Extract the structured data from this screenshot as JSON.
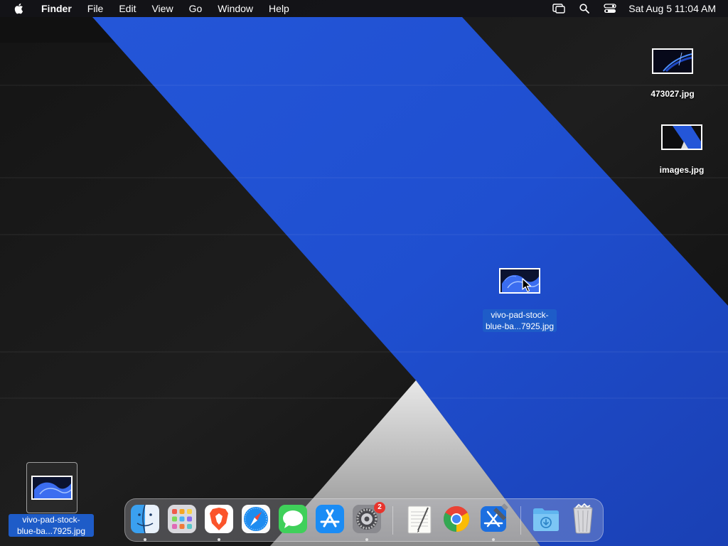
{
  "menubar": {
    "apple_icon": "apple-icon",
    "app_name": "Finder",
    "menus": [
      "File",
      "Edit",
      "View",
      "Go",
      "Window",
      "Help"
    ],
    "status_icons": [
      "screen-mirroring-icon",
      "spotlight-search-icon",
      "control-center-icon"
    ],
    "clock": "Sat Aug 5  11:04 AM"
  },
  "desktop": {
    "icons": [
      {
        "name": "473027.jpg",
        "selected": false
      },
      {
        "name": "images.jpg",
        "selected": false
      },
      {
        "name_line1": "vivo-pad-stock-",
        "name_line2": "blue-ba...7925.jpg",
        "selected": true
      }
    ],
    "drag_ghost": {
      "name_line1": "vivo-pad-stock-",
      "name_line2": "blue-ba...7925.jpg"
    }
  },
  "dock": {
    "apps": [
      {
        "name": "Finder",
        "icon": "finder-icon",
        "running": true
      },
      {
        "name": "Launchpad",
        "icon": "launchpad-icon",
        "running": false
      },
      {
        "name": "Brave Browser",
        "icon": "brave-icon",
        "running": true
      },
      {
        "name": "Safari",
        "icon": "safari-icon",
        "running": false
      },
      {
        "name": "Messages",
        "icon": "messages-icon",
        "running": false
      },
      {
        "name": "App Store",
        "icon": "app-store-icon",
        "running": false
      },
      {
        "name": "System Settings",
        "icon": "settings-icon",
        "running": true,
        "badge": "2"
      },
      {
        "name": "TextEdit",
        "icon": "textedit-icon",
        "running": false
      },
      {
        "name": "Google Chrome",
        "icon": "chrome-icon",
        "running": false
      },
      {
        "name": "Xcode",
        "icon": "xcode-icon",
        "running": true
      },
      {
        "name": "Downloads",
        "icon": "downloads-folder-icon",
        "running": false
      },
      {
        "name": "Trash",
        "icon": "trash-icon",
        "running": false
      }
    ]
  },
  "colors": {
    "wallpaper_blue": "#1f4fd0",
    "selection_blue": "#1e5cc8",
    "badge_red": "#e8342d"
  }
}
